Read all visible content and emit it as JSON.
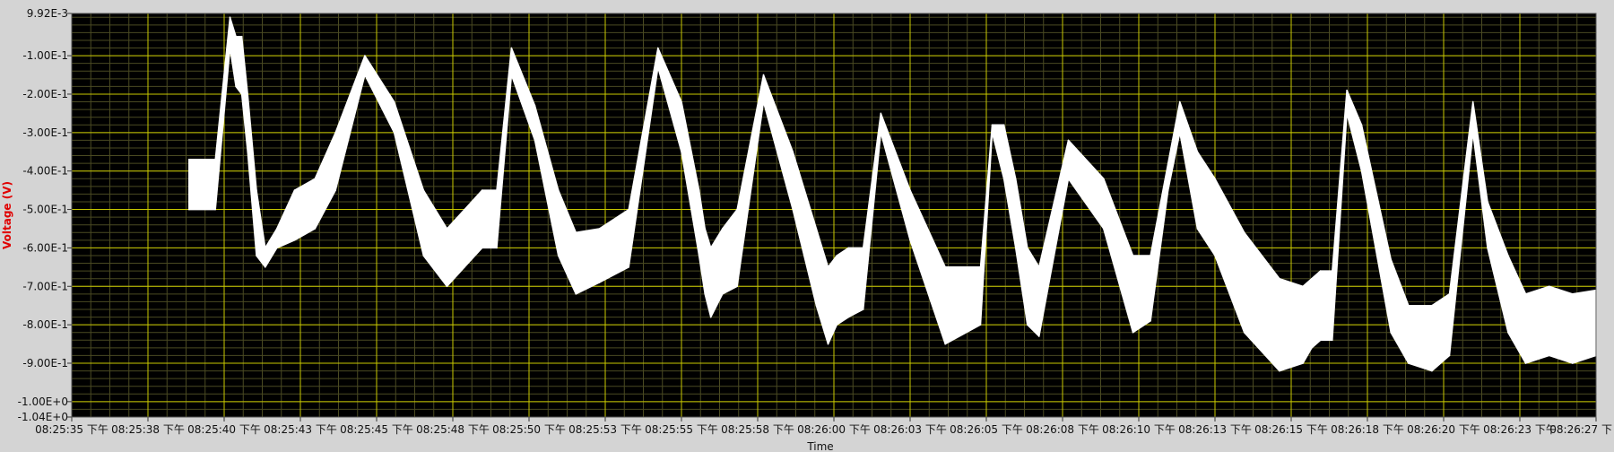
{
  "chart_data": {
    "type": "line",
    "title": "",
    "xlabel": "Time",
    "ylabel": "Voltage (V)",
    "ylim": [
      -1.04,
      0.00992
    ],
    "y_ticks": [
      {
        "value": 0.00992,
        "label": "9.92E-3"
      },
      {
        "value": -0.1,
        "label": "-1.00E-1"
      },
      {
        "value": -0.2,
        "label": "-2.00E-1"
      },
      {
        "value": -0.3,
        "label": "-3.00E-1"
      },
      {
        "value": -0.4,
        "label": "-4.00E-1"
      },
      {
        "value": -0.5,
        "label": "-5.00E-1"
      },
      {
        "value": -0.6,
        "label": "-6.00E-1"
      },
      {
        "value": -0.7,
        "label": "-7.00E-1"
      },
      {
        "value": -0.8,
        "label": "-8.00E-1"
      },
      {
        "value": -0.9,
        "label": "-9.00E-1"
      },
      {
        "value": -1.0,
        "label": "-1.00E+0"
      },
      {
        "value": -1.04,
        "label": "-1.04E+0"
      }
    ],
    "x_ticks": [
      "08:25:35 下午",
      "08:25:38 下午",
      "08:25:40 下午",
      "08:25:43 下午",
      "08:25:45 下午",
      "08:25:48 下午",
      "08:25:50 下午",
      "08:25:53 下午",
      "08:25:55 下午",
      "08:25:58 下午",
      "08:26:00 下午",
      "08:26:03 下午",
      "08:26:05 下午",
      "08:26:08 下午",
      "08:26:10 下午",
      "08:26:13 下午",
      "08:26:15 下午",
      "08:26:18 下午",
      "08:26:20 下午",
      "08:26:23 下午",
      "08:26:27 下"
    ],
    "x_start_seconds": 0,
    "x_end_seconds": 52,
    "grid": true,
    "colors": {
      "background": "#000000",
      "grid_major": "#c8c800",
      "grid_minor": "#4a4a22",
      "trace": "#ffffff",
      "frame": "#d4d4d4"
    },
    "series": [
      {
        "x": [
          4.0,
          4.9,
          5.4,
          5.6,
          5.8,
          6.0,
          6.3,
          6.6,
          7.0,
          7.6,
          8.3,
          9.0,
          10.0,
          11.0,
          12.0,
          12.8,
          13.4,
          14.0,
          14.5,
          15.0,
          15.8,
          16.6,
          17.2,
          18.0,
          19.0,
          20.0,
          20.8,
          21.4,
          21.6,
          21.8,
          22.2,
          22.7,
          23.6,
          24.6,
          25.4,
          25.8,
          26.1,
          26.5,
          27.0,
          27.6,
          28.6,
          29.8,
          31.0,
          31.4,
          31.8,
          32.2,
          32.6,
          33.0,
          34.0,
          35.2,
          36.2,
          36.8,
          37.4,
          37.8,
          38.4,
          39.0,
          40.0,
          41.2,
          42.0,
          42.3,
          42.6,
          43.0,
          43.5,
          44.0,
          45.0,
          45.6,
          46.4,
          47.0,
          47.8,
          48.3,
          49.0,
          49.6,
          50.4,
          51.2,
          52.0
        ],
        "y_top": [
          -0.37,
          -0.37,
          0.0,
          -0.05,
          -0.05,
          -0.2,
          -0.45,
          -0.6,
          -0.55,
          -0.45,
          -0.42,
          -0.3,
          -0.1,
          -0.22,
          -0.45,
          -0.55,
          -0.5,
          -0.45,
          -0.45,
          -0.08,
          -0.23,
          -0.45,
          -0.56,
          -0.55,
          -0.5,
          -0.08,
          -0.22,
          -0.45,
          -0.55,
          -0.6,
          -0.55,
          -0.5,
          -0.15,
          -0.35,
          -0.55,
          -0.65,
          -0.62,
          -0.6,
          -0.6,
          -0.25,
          -0.45,
          -0.65,
          -0.65,
          -0.28,
          -0.28,
          -0.42,
          -0.6,
          -0.65,
          -0.32,
          -0.42,
          -0.62,
          -0.62,
          -0.38,
          -0.22,
          -0.35,
          -0.42,
          -0.56,
          -0.68,
          -0.7,
          -0.68,
          -0.66,
          -0.66,
          -0.19,
          -0.28,
          -0.63,
          -0.75,
          -0.75,
          -0.72,
          -0.22,
          -0.48,
          -0.62,
          -0.72,
          -0.7,
          -0.72,
          -0.71
        ],
        "y_bottom": [
          -0.5,
          -0.5,
          -0.08,
          -0.18,
          -0.2,
          -0.35,
          -0.62,
          -0.65,
          -0.6,
          -0.58,
          -0.55,
          -0.45,
          -0.15,
          -0.3,
          -0.62,
          -0.7,
          -0.65,
          -0.6,
          -0.6,
          -0.15,
          -0.32,
          -0.62,
          -0.72,
          -0.69,
          -0.65,
          -0.13,
          -0.35,
          -0.62,
          -0.72,
          -0.78,
          -0.72,
          -0.7,
          -0.22,
          -0.5,
          -0.75,
          -0.85,
          -0.8,
          -0.78,
          -0.76,
          -0.3,
          -0.58,
          -0.85,
          -0.8,
          -0.3,
          -0.42,
          -0.6,
          -0.8,
          -0.83,
          -0.42,
          -0.55,
          -0.82,
          -0.79,
          -0.45,
          -0.3,
          -0.55,
          -0.62,
          -0.82,
          -0.92,
          -0.9,
          -0.86,
          -0.84,
          -0.84,
          -0.25,
          -0.4,
          -0.82,
          -0.9,
          -0.92,
          -0.88,
          -0.3,
          -0.6,
          -0.82,
          -0.9,
          -0.88,
          -0.9,
          -0.88
        ]
      }
    ]
  }
}
